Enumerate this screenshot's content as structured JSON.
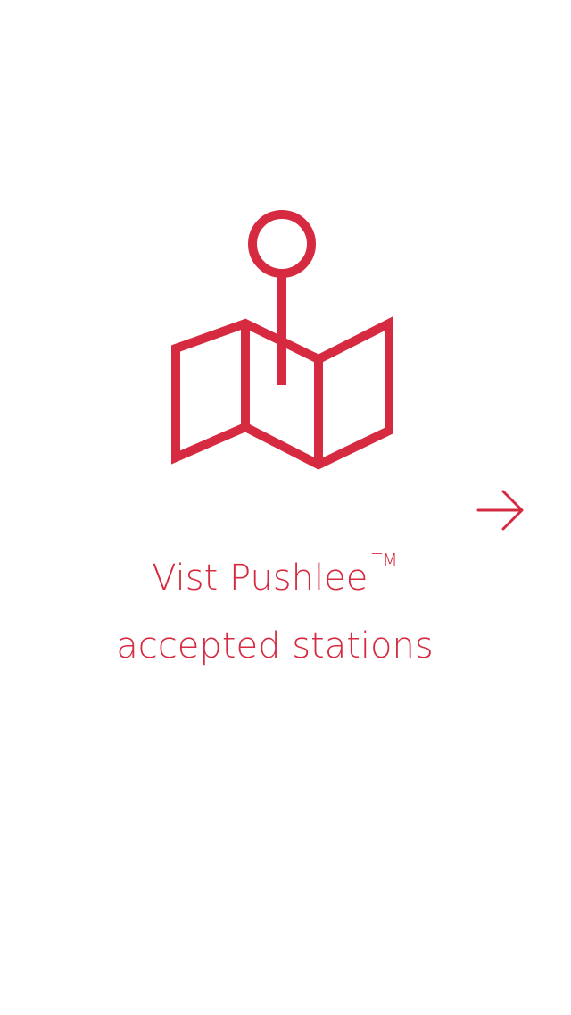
{
  "theme": {
    "accent": "#d62a40",
    "background": "#ffffff"
  },
  "illustration": {
    "icon": "map-pin-icon"
  },
  "navigation": {
    "next_icon": "arrow-right-icon"
  },
  "caption": {
    "line1": "Vist Pushlee",
    "trademark": "TM",
    "line2": "accepted stations"
  }
}
